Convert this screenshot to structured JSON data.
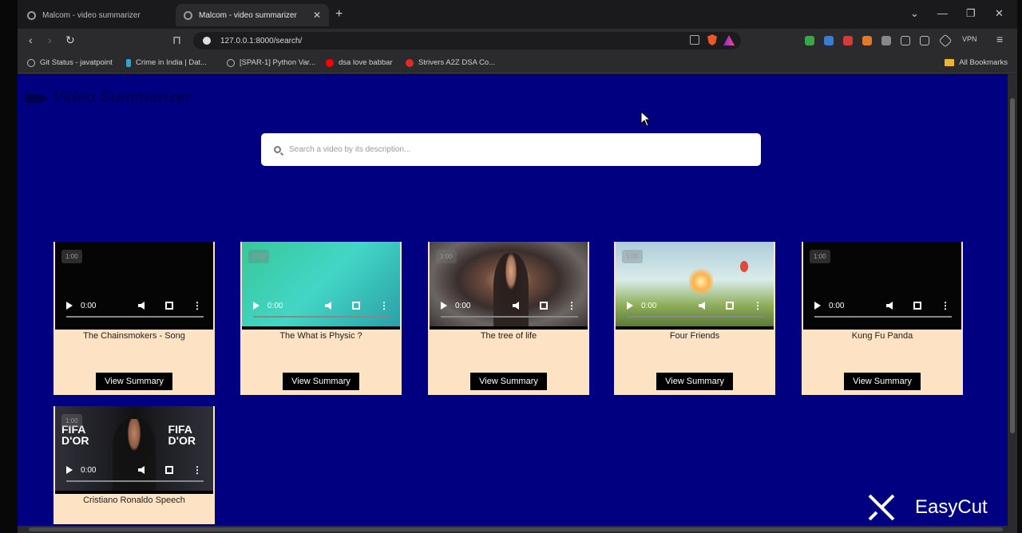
{
  "browser": {
    "tabs": [
      {
        "label": "Malcom - video summarizer",
        "active": false
      },
      {
        "label": "Malcom - video summarizer",
        "active": true
      }
    ],
    "url": "127.0.0.1:8000/search/",
    "vpn_label": "VPN",
    "bookmarks": [
      {
        "label": "Git Status - javatpoint",
        "icon_color": "#bbbbbb"
      },
      {
        "label": "Crime in India | Dat...",
        "icon_color": "#2ea3d9"
      },
      {
        "label": "[SPAR-1] Python Var...",
        "icon_color": "#bbbbbb"
      },
      {
        "label": "dsa love babbar",
        "icon_color": "#ff0000"
      },
      {
        "label": "Strivers A2Z DSA Co...",
        "icon_color": "#e02a2a"
      }
    ],
    "all_bookmarks": "All Bookmarks"
  },
  "page": {
    "brand": "Video Summarizer",
    "background_color": "#010080",
    "search_placeholder": "Search a video by its description...",
    "view_summary_label": "View Summary"
  },
  "videos": [
    {
      "title": "The Chainsmokers - Song",
      "duration": "1:00",
      "time": "0:00",
      "thumb": "black"
    },
    {
      "title": "The What is Physic ?",
      "duration": "1:00",
      "time": "0:00",
      "thumb": "teal"
    },
    {
      "title": "The tree of life",
      "duration": "1:00",
      "time": "0:00",
      "thumb": "person"
    },
    {
      "title": "Four Friends",
      "duration": "1:00",
      "time": "0:00",
      "thumb": "cartoon"
    },
    {
      "title": "Kung Fu Panda",
      "duration": "1:00",
      "time": "0:00",
      "thumb": "black"
    },
    {
      "title": "Cristiano Ronaldo Speech",
      "duration": "1:00",
      "time": "0:00",
      "thumb": "fifa"
    }
  ],
  "watermark": {
    "label": "EasyCut"
  }
}
